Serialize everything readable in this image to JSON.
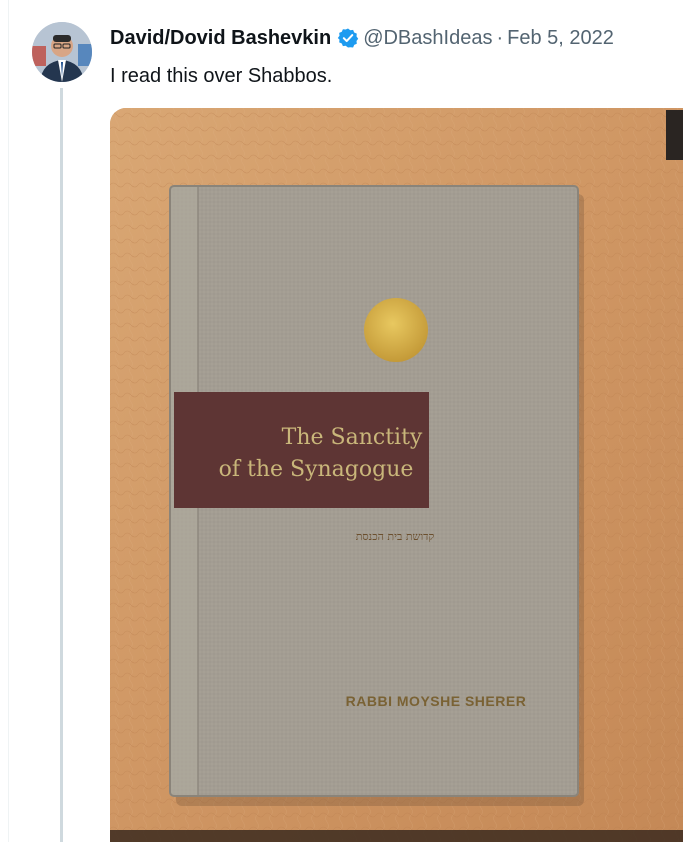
{
  "tweet": {
    "display_name": "David/Dovid Bashevkin",
    "handle": "@DBashIdeas",
    "separator": "·",
    "date": "Feb 5, 2022",
    "text": "I read this over Shabbos.",
    "verified": true
  },
  "media": {
    "book": {
      "title_line1": "The Sanctity",
      "title_line2": "of the Synagogue",
      "hebrew_subtitle": "קדושת בית הכנסת",
      "author": "RABBI MOYSHE SHERER"
    }
  },
  "colors": {
    "verified_blue": "#1d9bf0",
    "secondary_text": "#536471",
    "book_cloth": "#a39d92",
    "title_band": "#5e3534",
    "gold": "#c9a545",
    "leather": "#cf9a66"
  },
  "icons": {
    "verified": "verified-badge-icon",
    "avatar": "user-avatar"
  }
}
